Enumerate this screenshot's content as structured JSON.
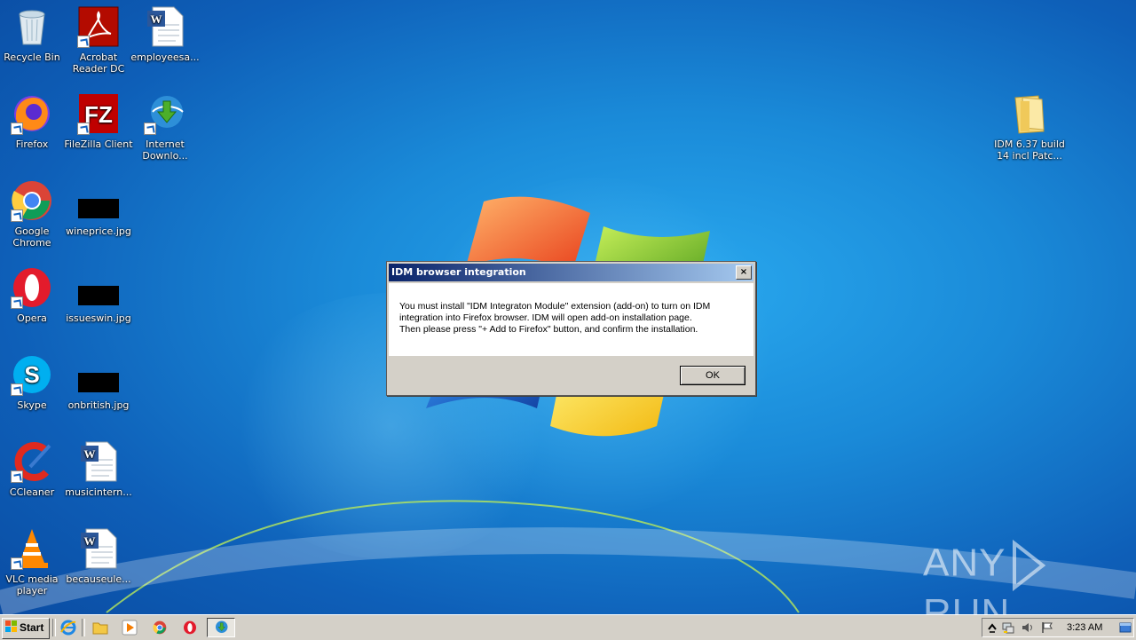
{
  "desktop_icons": [
    {
      "label": "Recycle Bin",
      "icon": "recycle-bin-icon"
    },
    {
      "label": "Acrobat\nReader DC",
      "icon": "acrobat-icon"
    },
    {
      "label": "employeesa...",
      "icon": "word-document-icon"
    },
    {
      "label": "Firefox",
      "icon": "firefox-icon"
    },
    {
      "label": "FileZilla Client",
      "icon": "filezilla-icon"
    },
    {
      "label": "Internet\nDownlo...",
      "icon": "idm-icon"
    },
    {
      "label": "Google\nChrome",
      "icon": "chrome-icon"
    },
    {
      "label": "wineprice.jpg",
      "icon": "image-file-icon"
    },
    {
      "label": "Opera",
      "icon": "opera-icon"
    },
    {
      "label": "issueswin.jpg",
      "icon": "image-file-icon"
    },
    {
      "label": "Skype",
      "icon": "skype-icon"
    },
    {
      "label": "onbritish.jpg",
      "icon": "image-file-icon"
    },
    {
      "label": "CCleaner",
      "icon": "ccleaner-icon"
    },
    {
      "label": "musicintern...",
      "icon": "word-document-icon"
    },
    {
      "label": "VLC media\nplayer",
      "icon": "vlc-icon"
    },
    {
      "label": "becauseule...",
      "icon": "word-document-icon"
    },
    {
      "label": "IDM 6.37 build\n14 incl Patc...",
      "icon": "folder-icon"
    }
  ],
  "dialog": {
    "title": "IDM browser integration",
    "close_label": "×",
    "message_lines": [
      "You must install \"IDM Integraton Module\" extension (add-on) to turn on IDM",
      "integration into Firefox browser. IDM will open add-on installation page.",
      "Then please press \"+ Add to Firefox\" button, and confirm the installation."
    ],
    "ok_label": "OK"
  },
  "watermark": {
    "left": "ANY",
    "right": "RUN"
  },
  "taskbar": {
    "start_label": "Start",
    "pinned": [
      "internet-explorer-icon",
      "file-explorer-icon",
      "media-player-icon",
      "chrome-icon",
      "opera-icon",
      "idm-icon"
    ],
    "tray_icons": [
      "show-hidden-icons-icon",
      "network-icon",
      "volume-icon",
      "action-center-flag-icon"
    ],
    "clock": "3:23 AM"
  }
}
